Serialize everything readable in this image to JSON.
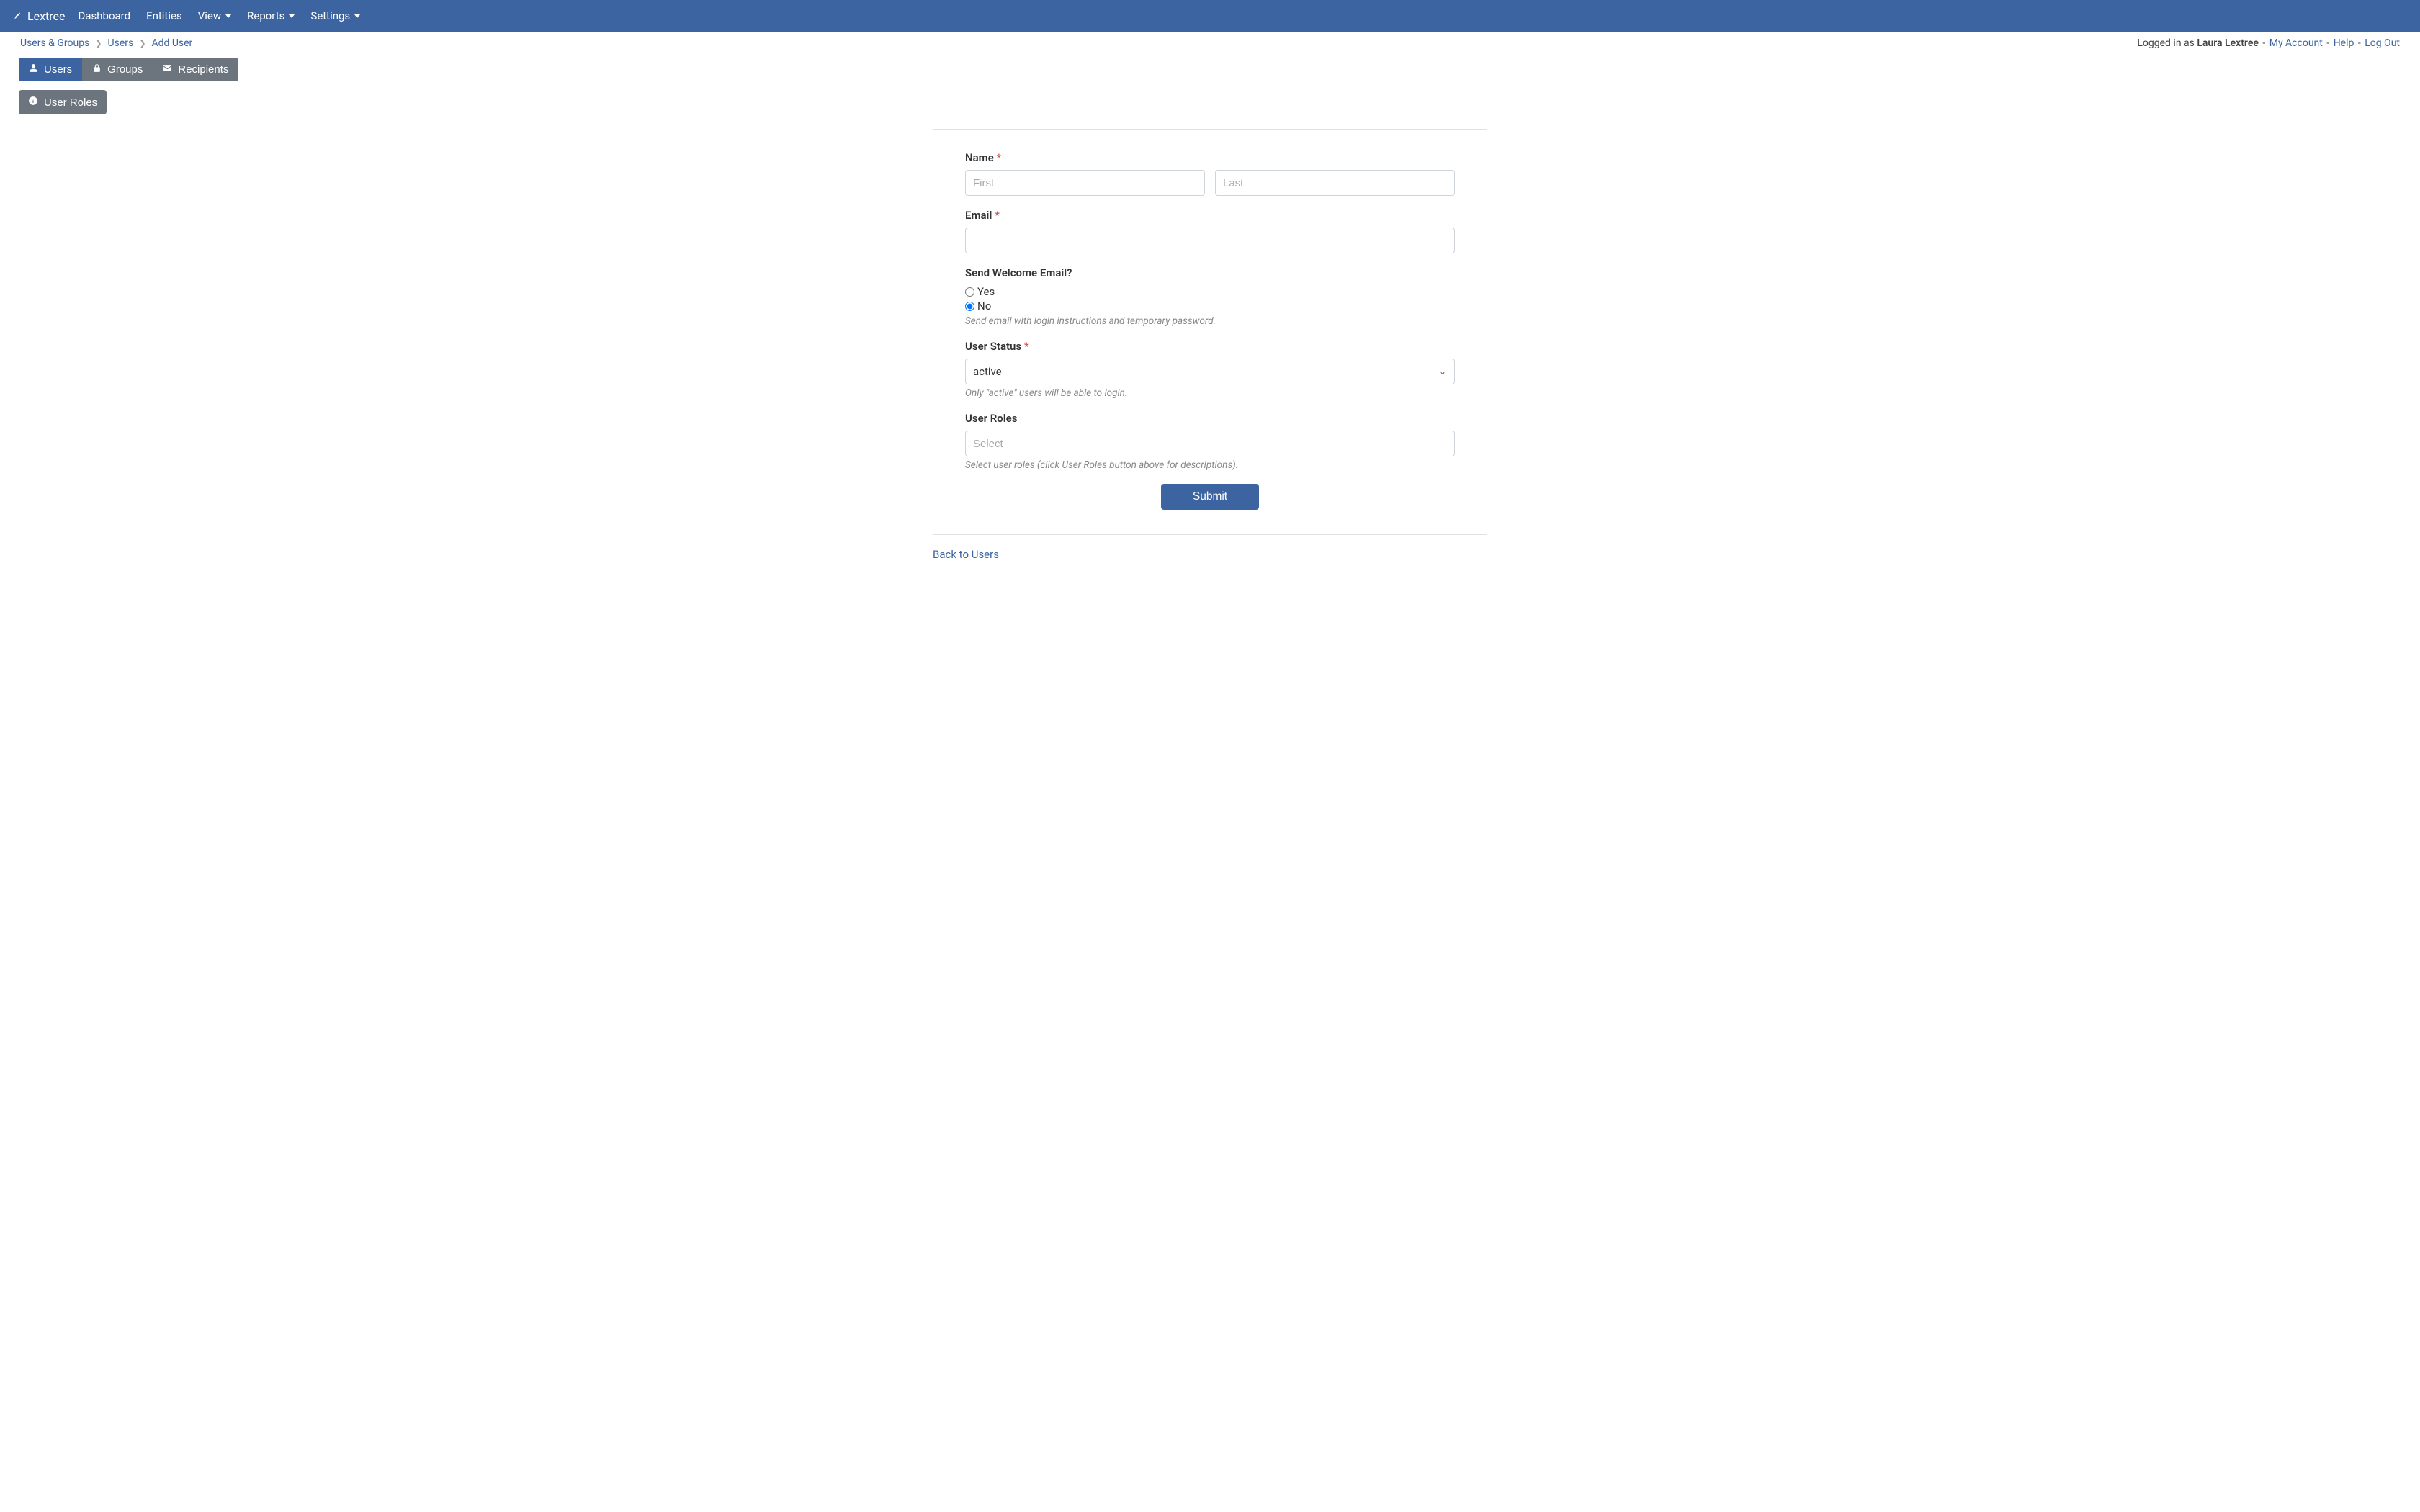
{
  "brand": "Lextree",
  "nav": {
    "dashboard": "Dashboard",
    "entities": "Entities",
    "view": "View",
    "reports": "Reports",
    "settings": "Settings"
  },
  "breadcrumb": {
    "root": "Users & Groups",
    "mid": "Users",
    "leaf": "Add User"
  },
  "login": {
    "prefix": "Logged in as ",
    "user": "Laura Lextree",
    "my_account": "My Account",
    "help": "Help",
    "logout": "Log Out"
  },
  "tabs": {
    "users": "Users",
    "groups": "Groups",
    "recipients": "Recipients"
  },
  "roles_button": "User Roles",
  "form": {
    "name_label": "Name",
    "first_placeholder": "First",
    "last_placeholder": "Last",
    "email_label": "Email",
    "welcome_label": "Send Welcome Email?",
    "welcome_yes": "Yes",
    "welcome_no": "No",
    "welcome_help": "Send email with login instructions and temporary password.",
    "status_label": "User Status",
    "status_value": "active",
    "status_help": "Only \"active\" users will be able to login.",
    "roles_label": "User Roles",
    "roles_placeholder": "Select",
    "roles_help": "Select user roles (click User Roles button above for descriptions).",
    "submit": "Submit"
  },
  "back_link": "Back to Users"
}
